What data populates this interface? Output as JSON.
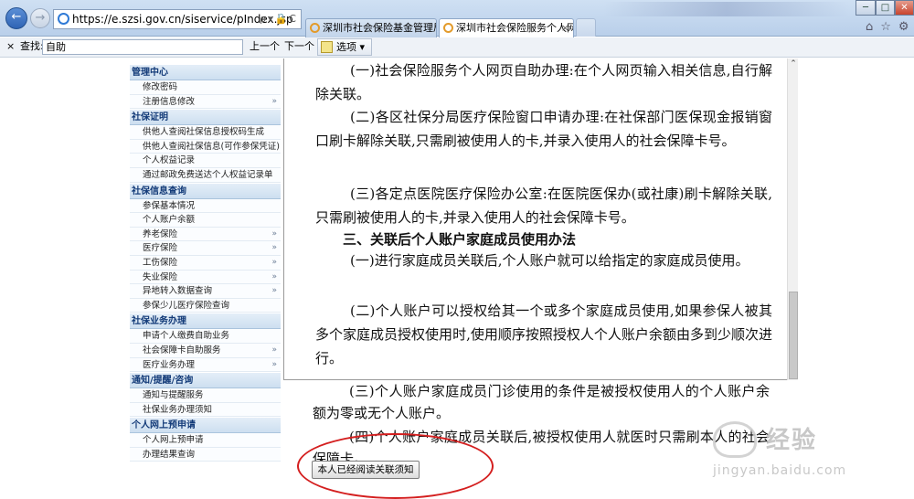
{
  "browser": {
    "address": "https://e.szsi.gov.cn/siservice/pIndex.jsp",
    "address_tools": "ρ▾🔒C",
    "tabs": [
      {
        "label": "深圳市社会保险基金管理局"
      },
      {
        "label": "深圳市社会保险服务个人网页",
        "close": "×"
      }
    ],
    "back_glyph": "←",
    "forward_glyph": "→",
    "window_buttons": {
      "minimize": "─",
      "maximize": "□",
      "close": "✕"
    },
    "right_icons": "⌂☆⚙"
  },
  "findbar": {
    "close": "×",
    "label": "查找:",
    "query": "自助",
    "prev": "上一个",
    "next": "下一个",
    "options": "选项 ▾"
  },
  "sidebar": {
    "sections": [
      {
        "title": "管理中心",
        "items": [
          {
            "label": "修改密码",
            "arrow": ""
          },
          {
            "label": "注册信息修改",
            "arrow": "»"
          }
        ]
      },
      {
        "title": "社保证明",
        "items": [
          {
            "label": "供他人查阅社保信息授权码生成",
            "arrow": ""
          },
          {
            "label": "供他人查阅社保信息(可作参保凭证)",
            "arrow": ""
          },
          {
            "label": "个人权益记录",
            "arrow": ""
          },
          {
            "label": "通过邮政免费送达个人权益记录单",
            "arrow": ""
          }
        ]
      },
      {
        "title": "社保信息查询",
        "items": [
          {
            "label": "参保基本情况",
            "arrow": ""
          },
          {
            "label": "个人账户余额",
            "arrow": ""
          },
          {
            "label": "养老保险",
            "arrow": "»"
          },
          {
            "label": "医疗保险",
            "arrow": "»"
          },
          {
            "label": "工伤保险",
            "arrow": "»"
          },
          {
            "label": "失业保险",
            "arrow": "»"
          },
          {
            "label": "异地转入数据查询",
            "arrow": "»"
          },
          {
            "label": "参保少儿医疗保险查询",
            "arrow": ""
          }
        ]
      },
      {
        "title": "社保业务办理",
        "items": [
          {
            "label": "申请个人缴费自助业务",
            "arrow": ""
          },
          {
            "label": "社会保障卡自助服务",
            "arrow": "»"
          },
          {
            "label": "医疗业务办理",
            "arrow": "»"
          }
        ]
      },
      {
        "title": "通知/提醒/咨询",
        "items": [
          {
            "label": "通知与提醒服务",
            "arrow": ""
          },
          {
            "label": "社保业务办理须知",
            "arrow": ""
          }
        ]
      },
      {
        "title": "个人网上预申请",
        "items": [
          {
            "label": "个人网上预申请",
            "arrow": ""
          },
          {
            "label": "办理结果查询",
            "arrow": ""
          }
        ]
      }
    ]
  },
  "document": {
    "paragraphs": [
      "(一)社会保险服务个人网页自助办理:在个人网页输入相关信息,自行解除关联。",
      "(二)各区社保分局医疗保险窗口申请办理:在社保部门医保现金报销窗口刷卡解除关联,只需刷被使用人的卡,并录入使用人的社会保障卡号。",
      "(三)各定点医院医疗保险办公室:在医院医保办(或社康)刷卡解除关联,只需刷被使用人的卡,并录入使用人的社会保障卡号。",
      "三、关联后个人账户家庭成员使用办法",
      "(一)进行家庭成员关联后,个人账户就可以给指定的家庭成员使用。",
      "(二)个人账户可以授权给其一个或多个家庭成员使用,如果参保人被其多个家庭成员授权使用时,使用顺序按照授权人个人账户余额由多到少顺次进行。"
    ],
    "below_paragraphs": [
      "(三)个人账户家庭成员门诊使用的条件是被授权使用人的个人账户余额为零或无个人账户。",
      "(四)个人账户家庭成员关联后,被授权使用人就医时只需刷本人的社会保障卡。"
    ],
    "scroll_up": "⌃",
    "ack_button": "本人已经阅读关联须知"
  },
  "watermark": {
    "cn": "经验",
    "url": "jingyan.baidu.com"
  },
  "colors": {
    "annotation": "#d41f1f",
    "sidebar_section": "#123a78"
  }
}
